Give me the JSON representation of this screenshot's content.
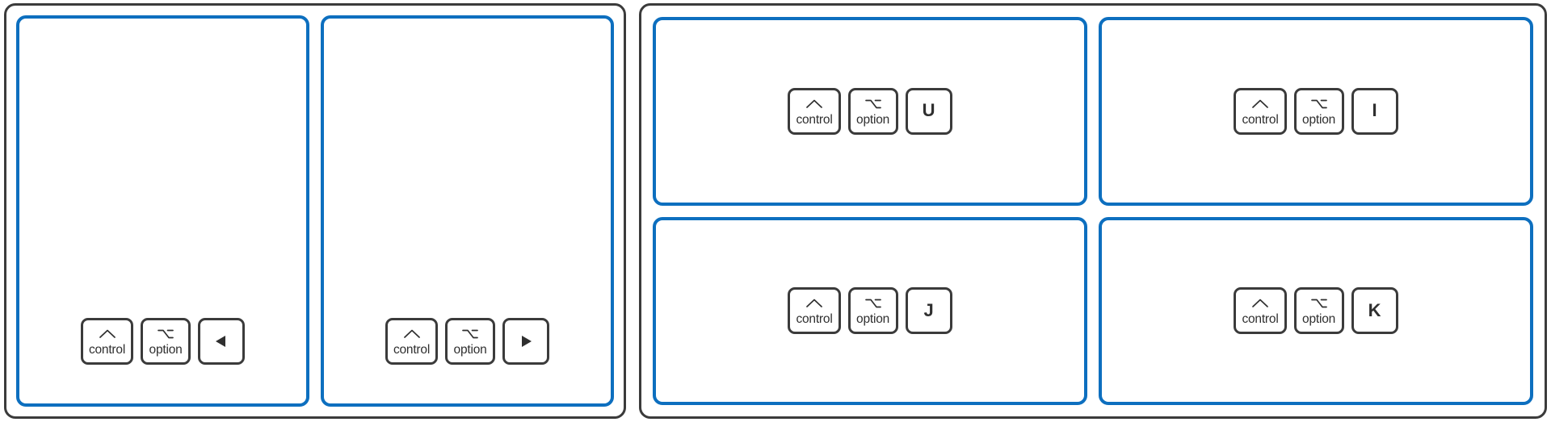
{
  "accent_colors": {
    "panel_border_blue": "#0d6fbf",
    "outline_dark": "#3b3b3b",
    "key_text": "#2f2f2f",
    "background": "#ffffff"
  },
  "keys": {
    "control": {
      "label": "control",
      "glyph_name": "control-caret-glyph"
    },
    "option": {
      "label": "option",
      "glyph_name": "option-alt-glyph"
    },
    "arrow_left": {
      "label": "◀",
      "glyph_name": "arrow-left-icon"
    },
    "arrow_right": {
      "label": "▶",
      "glyph_name": "arrow-right-icon"
    },
    "u": {
      "label": "U"
    },
    "i": {
      "label": "I"
    },
    "j": {
      "label": "J"
    },
    "k": {
      "label": "K"
    }
  },
  "groups": [
    {
      "id": "group-left",
      "panels": [
        {
          "id": "panel-left-arrow",
          "shortcut": [
            "control",
            "option",
            "arrow_left"
          ],
          "keys": [
            {
              "type": "modifier",
              "glyph": "control-caret-glyph",
              "label": "control"
            },
            {
              "type": "modifier",
              "glyph": "option-alt-glyph",
              "label": "option"
            },
            {
              "type": "arrow",
              "glyph": "arrow-left-icon",
              "label": "◀"
            }
          ]
        },
        {
          "id": "panel-right-arrow",
          "shortcut": [
            "control",
            "option",
            "arrow_right"
          ],
          "keys": [
            {
              "type": "modifier",
              "glyph": "control-caret-glyph",
              "label": "control"
            },
            {
              "type": "modifier",
              "glyph": "option-alt-glyph",
              "label": "option"
            },
            {
              "type": "arrow",
              "glyph": "arrow-right-icon",
              "label": "▶"
            }
          ]
        }
      ]
    },
    {
      "id": "group-right",
      "panels": [
        {
          "id": "panel-u",
          "shortcut": [
            "control",
            "option",
            "u"
          ],
          "keys": [
            {
              "type": "modifier",
              "glyph": "control-caret-glyph",
              "label": "control"
            },
            {
              "type": "modifier",
              "glyph": "option-alt-glyph",
              "label": "option"
            },
            {
              "type": "letter",
              "label": "U"
            }
          ]
        },
        {
          "id": "panel-i",
          "shortcut": [
            "control",
            "option",
            "i"
          ],
          "keys": [
            {
              "type": "modifier",
              "glyph": "control-caret-glyph",
              "label": "control"
            },
            {
              "type": "modifier",
              "glyph": "option-alt-glyph",
              "label": "option"
            },
            {
              "type": "letter",
              "label": "I"
            }
          ]
        },
        {
          "id": "panel-j",
          "shortcut": [
            "control",
            "option",
            "j"
          ],
          "keys": [
            {
              "type": "modifier",
              "glyph": "control-caret-glyph",
              "label": "control"
            },
            {
              "type": "modifier",
              "glyph": "option-alt-glyph",
              "label": "option"
            },
            {
              "type": "letter",
              "label": "J"
            }
          ]
        },
        {
          "id": "panel-k",
          "shortcut": [
            "control",
            "option",
            "k"
          ],
          "keys": [
            {
              "type": "modifier",
              "glyph": "control-caret-glyph",
              "label": "control"
            },
            {
              "type": "modifier",
              "glyph": "option-alt-glyph",
              "label": "option"
            },
            {
              "type": "letter",
              "label": "K"
            }
          ]
        }
      ]
    }
  ]
}
